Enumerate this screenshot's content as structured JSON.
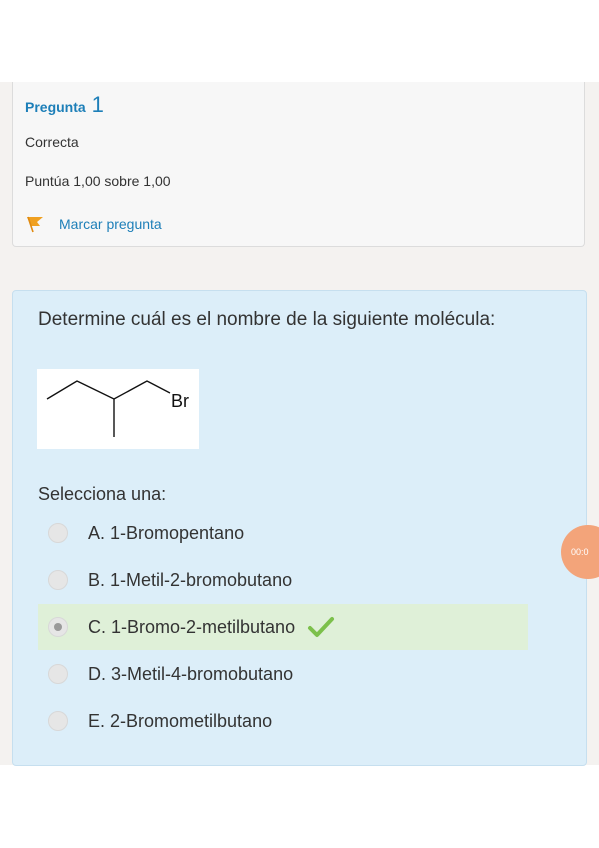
{
  "question": {
    "title_label": "Pregunta",
    "number": "1",
    "state": "Correcta",
    "grade": "Puntúa 1,00 sobre 1,00",
    "flag_label": "Marcar pregunta",
    "text": "Determine cuál es el nombre de la siguiente molécula:",
    "molecule_label": "Br",
    "prompt": "Selecciona una:",
    "options": [
      {
        "label": "A. 1-Bromopentano",
        "selected": false,
        "correct": false
      },
      {
        "label": "B. 1-Metil-2-bromobutano",
        "selected": false,
        "correct": false
      },
      {
        "label": "C. 1-Bromo-2-metilbutano",
        "selected": true,
        "correct": true
      },
      {
        "label": "D. 3-Metil-4-bromobutano",
        "selected": false,
        "correct": false
      },
      {
        "label": "E. 2-Bromometilbutano",
        "selected": false,
        "correct": false
      }
    ]
  },
  "timer": {
    "text": "00:0"
  },
  "colors": {
    "accent": "#1d7fb8",
    "question_bg": "#dceef9",
    "correct_bg": "#dff0d8",
    "check": "#7cc04b",
    "flag": "#f0a020"
  },
  "icons": {
    "flag": "flag-icon",
    "check": "check-icon",
    "radio": "radio-icon"
  }
}
